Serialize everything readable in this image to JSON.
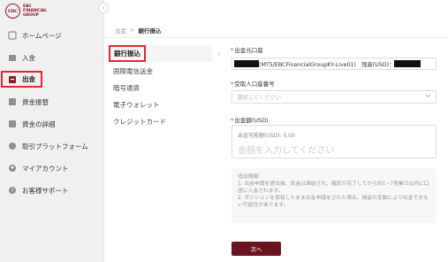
{
  "brand": {
    "mark": "EBC",
    "line1": "EBC",
    "line2": "FINANCIAL",
    "line3": "GROUP"
  },
  "sidebar": {
    "collapse_icon": "‹",
    "items": [
      {
        "label": "ホームページ",
        "icon": "home-icon"
      },
      {
        "label": "入金",
        "icon": "deposit-icon"
      },
      {
        "label": "出金",
        "icon": "withdraw-icon"
      },
      {
        "label": "資金振替",
        "icon": "transfer-icon"
      },
      {
        "label": "資金の詳細",
        "icon": "details-icon"
      },
      {
        "label": "取引プラットフォーム",
        "icon": "platform-icon"
      },
      {
        "label": "マイアカウント",
        "icon": "account-icon"
      },
      {
        "label": "お客様サポート",
        "icon": "support-icon"
      }
    ]
  },
  "breadcrumb": {
    "parent": "出金",
    "separator": ">",
    "current": "銀行振込"
  },
  "methods": {
    "items": [
      "銀行振込",
      "国際電信送金",
      "暗号通貨",
      "電子ウォレット",
      "クレジットカード"
    ],
    "collapse_icon": "‹"
  },
  "form": {
    "source_label": "出金元口座",
    "source_value": "(MT5/EBCFinancialGroupKY-Live01)　残高(USD)：",
    "dest_label": "受取人口座番号",
    "dest_placeholder": "選択してください",
    "amount_label": "出金額(USD)",
    "amount_available": "出金可能額(USD): 0.00",
    "amount_placeholder": "金額を入力してください",
    "info_title": "追加情報：",
    "info_line1": "1. 出金申請を提出後、資金は凍結され、確認が完了してから約1~7営業日以内に口座に入金されます。",
    "info_line2": "2. ポジションを保有したまま出金申請をされた場合、損益の変動により出金できない可能性があります。",
    "next_label": "次へ"
  },
  "colors": {
    "accent": "#6b1420",
    "highlight": "#e8262e",
    "sidebar_bg": "#f0f0f0"
  }
}
